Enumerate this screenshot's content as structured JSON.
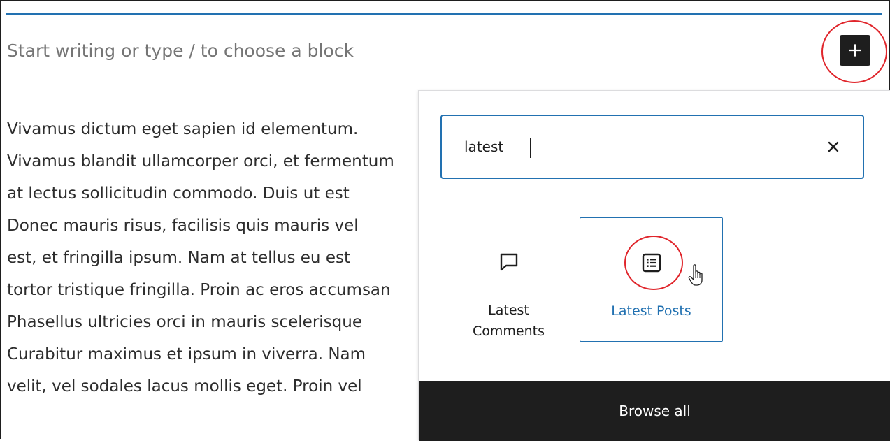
{
  "editor": {
    "placeholder": "Start writing or type / to choose a block",
    "paragraph_lines": [
      "Vivamus dictum eget sapien id elementum.",
      "Vivamus blandit ullamcorper orci, et fermentum",
      "at lectus sollicitudin commodo. Duis ut est",
      "Donec mauris risus, facilisis quis mauris vel",
      "est, et fringilla ipsum. Nam at tellus eu est",
      "tortor tristique fringilla. Proin ac eros accumsan",
      "Phasellus ultricies orci in mauris scelerisque",
      "Curabitur maximus et ipsum in viverra. Nam",
      "velit, vel sodales lacus mollis eget. Proin vel"
    ]
  },
  "inserter": {
    "toggle_icon": "plus-icon",
    "search": {
      "value": "latest",
      "clear_icon": "close-icon"
    },
    "results": [
      {
        "label": "Latest\nComments",
        "icon": "comment-icon"
      },
      {
        "label": "Latest Posts",
        "icon": "post-list-icon",
        "highlighted": true
      }
    ],
    "browse_all_label": "Browse all"
  },
  "colors": {
    "accent": "#2271b1",
    "annotation": "#e0252b",
    "dark": "#1e1e1e"
  }
}
